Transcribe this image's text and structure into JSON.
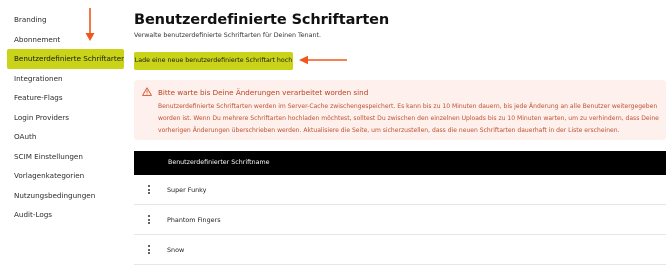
{
  "sidebar": {
    "items": [
      {
        "label": "Branding"
      },
      {
        "label": "Abonnement"
      },
      {
        "label": "Benutzerdefinierte Schriftarten",
        "active": true
      },
      {
        "label": "Integrationen"
      },
      {
        "label": "Feature-Flags"
      },
      {
        "label": "Login Providers"
      },
      {
        "label": "OAuth"
      },
      {
        "label": "SCIM Einstellungen"
      },
      {
        "label": "Vorlagenkategorien"
      },
      {
        "label": "Nutzungsbedingungen"
      },
      {
        "label": "Audit-Logs"
      }
    ]
  },
  "main": {
    "title": "Benutzerdefinierte Schriftarten",
    "subtitle": "Verwalte benutzerdefinierte Schriftarten für Deinen Tenant.",
    "upload_button": "Lade eine neue benutzerdefinierte Schriftart hoch",
    "alert": {
      "title": "Bitte warte bis Deine Änderungen verarbeitet worden sind",
      "body": "Benutzerdefinierte Schriftarten werden im Server-Cache zwischengespeichert. Es kann bis zu 10 Minuten dauern, bis jede Änderung an alle Benutzer weitergegeben worden ist. Wenn Du mehrere Schriftarten hochladen möchtest, solltest Du zwischen den einzelnen Uploads bis zu 10 Minuten warten, um zu verhindern, dass Deine vorherigen Änderungen überschrieben werden. Aktualisiere die Seite, um sicherzustellen, dass die neuen Schriftarten dauerhaft in der Liste erscheinen."
    },
    "table": {
      "header": "Benutzerdefinierter Schriftname",
      "rows": [
        {
          "name": "Super Funky"
        },
        {
          "name": "Phantom Fingers"
        },
        {
          "name": "Snow"
        }
      ]
    }
  },
  "colors": {
    "accent": "#c9d318",
    "annotation_arrow": "#f0561d",
    "alert_bg": "#fdf0ed",
    "alert_text": "#c0512e",
    "header_bg": "#000000"
  },
  "icons": {
    "alert": "warning-triangle-icon",
    "row_menu": "kebab-menu-icon"
  }
}
